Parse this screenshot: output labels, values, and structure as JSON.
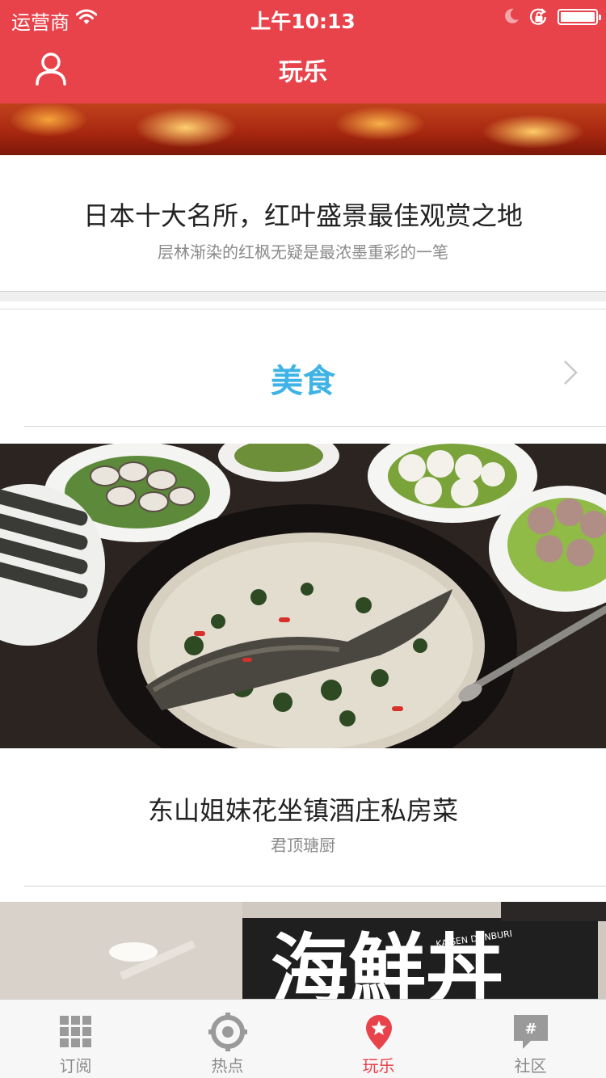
{
  "status_bar": {
    "carrier": "运营商",
    "time": "上午10:13"
  },
  "nav": {
    "title": "玩乐",
    "user_icon": "user-icon",
    "bar_color": "#e8434b"
  },
  "articles": [
    {
      "title": "日本十大名所，红叶盛景最佳观赏之地",
      "subtitle": "层林渐染的红枫无疑是最浓墨重彩的一笔"
    },
    {
      "title": "东山姐妹花坐镇酒庄私房菜",
      "subtitle": "君顶瑭厨"
    }
  ],
  "section": {
    "title": "美食",
    "title_color": "#3fb3e6"
  },
  "shop_sign": {
    "main_text": "海鮮丼",
    "romaji": "KAISEN DONBURI"
  },
  "tabs": [
    {
      "label": "订阅",
      "icon": "grid-icon",
      "active": false
    },
    {
      "label": "热点",
      "icon": "target-icon",
      "active": false
    },
    {
      "label": "玩乐",
      "icon": "star-pin-icon",
      "active": true
    },
    {
      "label": "社区",
      "icon": "hash-bubble-icon",
      "active": false
    }
  ],
  "accent_color": "#e8434b"
}
